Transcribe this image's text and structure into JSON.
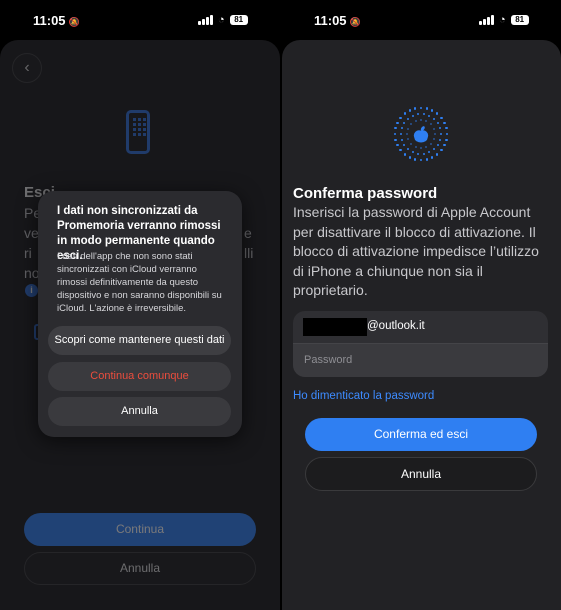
{
  "status": {
    "time": "11:05",
    "battery": "81"
  },
  "left": {
    "bg_title": "Esci",
    "bg_lines": [
      "Pe",
      "ve",
      "ri",
      "no"
    ],
    "bg_right_lines": [
      "e",
      "lli"
    ],
    "alert": {
      "title": "I dati non sincronizzati da Promemoria verranno rimossi in modo permanente quando esci.",
      "body": "I dati dell'app che non sono stati sincronizzati con iCloud verranno rimossi definitivamente da questo dispositivo e non saranno disponibili su iCloud. L'azione è irreversibile.",
      "learn_label": "Scopri come mantenere questi dati",
      "continue_label": "Continua comunque",
      "cancel_label": "Annulla"
    },
    "continue_label": "Continua",
    "cancel_label": "Annulla",
    "colors": {
      "accent": "#2f7ff2",
      "destructive": "#eb4d3d"
    }
  },
  "right": {
    "title": "Conferma password",
    "description": "Inserisci la password di Apple Account per disattivare il blocco di attivazione. Il blocco di attivazione impedisce l’utilizzo di iPhone a chiunque non sia il proprietario.",
    "email_suffix": "@outlook.it",
    "password_placeholder": "Password",
    "forgot_link": "Ho dimenticato la password",
    "confirm_label": "Conferma ed esci",
    "cancel_label": "Annulla"
  }
}
